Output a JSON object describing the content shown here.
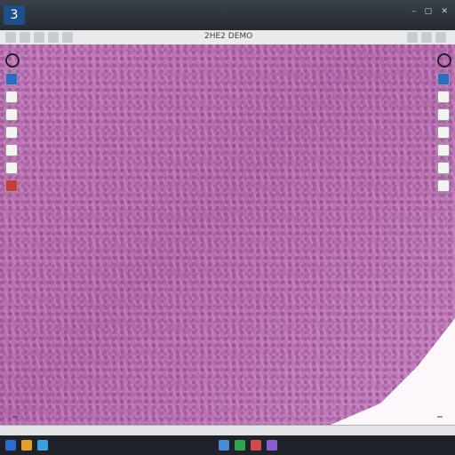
{
  "window": {
    "title": "",
    "app_icon": "3"
  },
  "toolbar": {
    "header_text": "2HE2 DEMO"
  },
  "viewer": {
    "overlay_label_left": "",
    "overlay_label_right": ""
  },
  "status": {
    "text": "",
    "zoom": ""
  },
  "taskbar": {
    "clock": ""
  },
  "icons": {
    "left": [
      "ring",
      "blue",
      "wrench",
      "pen",
      "line",
      "rect",
      "line",
      "red"
    ],
    "right": [
      "ring",
      "blue",
      "line",
      "line",
      "rect",
      "rect",
      "rect",
      "rect"
    ]
  }
}
